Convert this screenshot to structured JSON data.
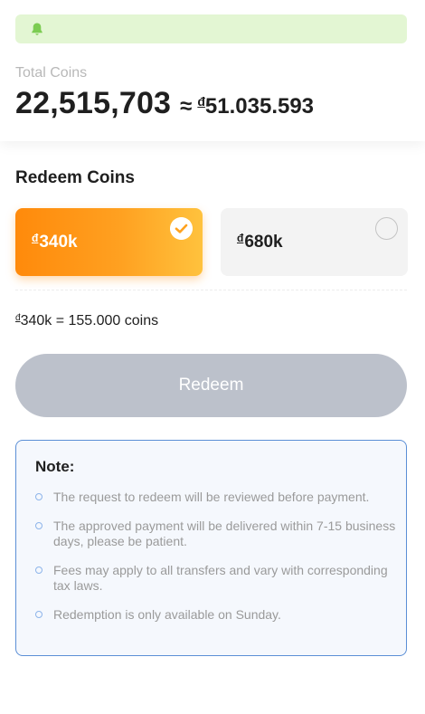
{
  "notice": {
    "icon": "bell-icon",
    "text": ""
  },
  "summary": {
    "label": "Total Coins",
    "coins": "22,515,703",
    "approx_symbol": "≈",
    "currency_symbol": "đ",
    "amount": "51.035.593"
  },
  "redeem": {
    "title": "Redeem Coins",
    "options": [
      {
        "currency": "đ",
        "label": "340k",
        "selected": true
      },
      {
        "currency": "đ",
        "label": "680k",
        "selected": false
      }
    ],
    "conversion": {
      "currency": "đ",
      "text": "340k = 155.000 coins"
    },
    "button_label": "Redeem"
  },
  "note": {
    "title": "Note:",
    "items": [
      "The request to redeem will be reviewed before payment.",
      "The approved payment will be delivered within 7-15 business days, please be patient.",
      "Fees may apply to all transfers and vary with corresponding tax laws.",
      "Redemption is only available on Sunday."
    ]
  },
  "colors": {
    "accent_orange": "#ff8a0b",
    "notice_green": "#e3f6d3",
    "bell_green": "#7ccc52",
    "button_disabled": "#bcc1cb",
    "note_border": "#5b8fd6"
  }
}
